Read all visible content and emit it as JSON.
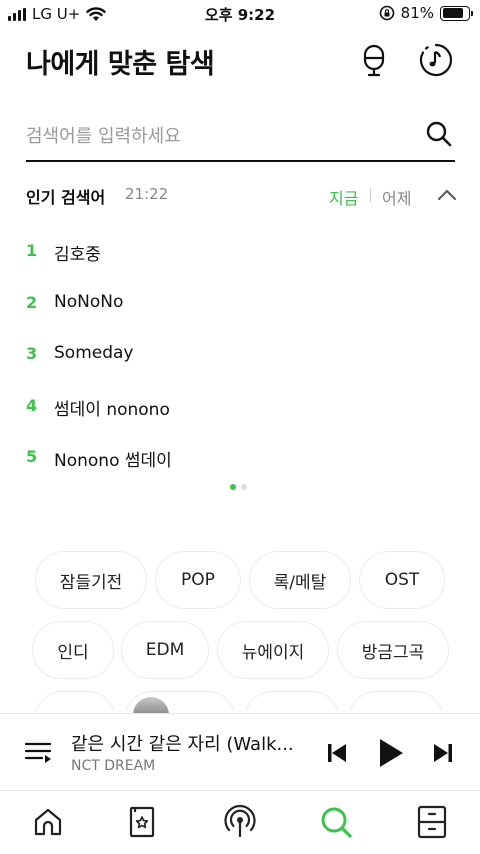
{
  "status_bar": {
    "carrier": "LG U+",
    "time": "오후 9:22",
    "battery": "81%",
    "battery_level": 0.81
  },
  "header": {
    "title": "나에게 맞춘 탐색"
  },
  "search": {
    "placeholder": "검색어를 입력하세요"
  },
  "popular": {
    "title": "인기 검색어",
    "time": "21:22",
    "tab_now": "지금",
    "tab_yesterday": "어제",
    "items": [
      {
        "rank": "1",
        "text": "김호중"
      },
      {
        "rank": "2",
        "text": "NoNoNo"
      },
      {
        "rank": "3",
        "text": "Someday"
      },
      {
        "rank": "4",
        "text": "썸데이 nonono"
      },
      {
        "rank": "5",
        "text": "Nonono 썸데이"
      }
    ],
    "page_count": 2,
    "active_page": 1
  },
  "genres": {
    "row1": [
      "잠들기전",
      "POP",
      "록/메탈",
      "OST"
    ],
    "row2": [
      "인디",
      "EDM",
      "뉴에이지",
      "방금그곡"
    ]
  },
  "player": {
    "title": "같은 시간 같은 자리 (Walk...",
    "artist": "NCT DREAM"
  },
  "tabs": [
    {
      "name": "home-icon",
      "active": false
    },
    {
      "name": "library-card-icon",
      "active": false
    },
    {
      "name": "podcast-icon",
      "active": false
    },
    {
      "name": "search-icon",
      "active": true
    },
    {
      "name": "storage-drawer-icon",
      "active": false
    }
  ],
  "colors": {
    "accent": "#3ec24d",
    "text": "#111111",
    "muted": "#888888"
  }
}
